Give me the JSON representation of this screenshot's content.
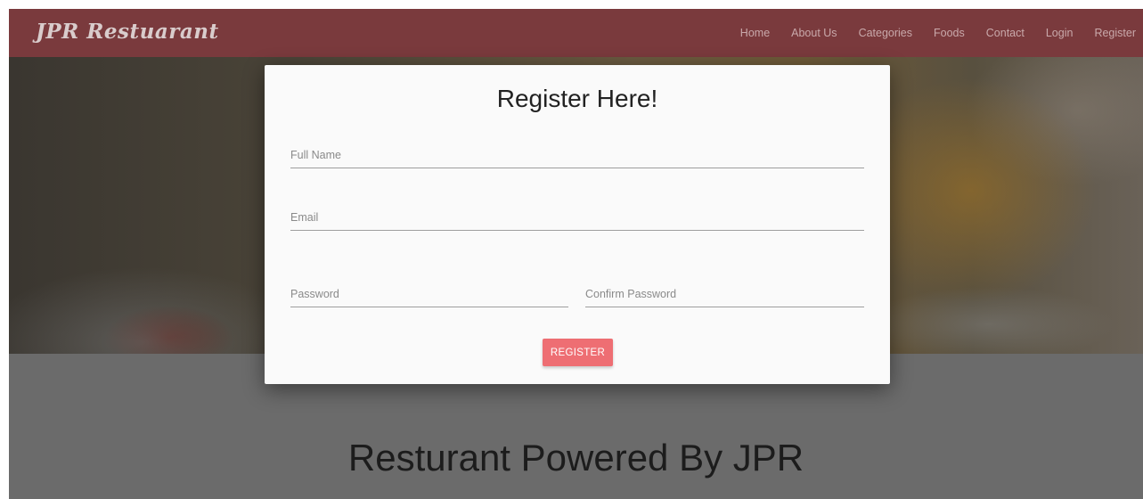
{
  "navbar": {
    "brand": "JPR Restuarant",
    "links": [
      "Home",
      "About Us",
      "Categories",
      "Foods",
      "Contact",
      "Login",
      "Register"
    ]
  },
  "modal": {
    "title": "Register Here!",
    "fields": {
      "full_name_placeholder": "Full Name",
      "email_placeholder": "Email",
      "password_placeholder": "Password",
      "confirm_password_placeholder": "Confirm Password"
    },
    "register_label": "REGISTER"
  },
  "hero": {
    "tagline": "Resturant Powered By JPR"
  },
  "colors": {
    "navbar": "#7a3a3d",
    "button": "#ee6e73",
    "overlay": "#6b6b6b"
  }
}
